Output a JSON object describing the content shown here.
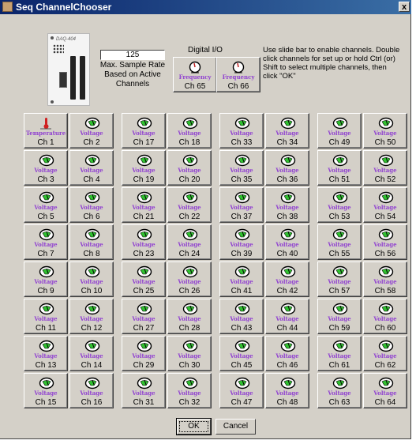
{
  "window": {
    "title": "Seq ChannelChooser",
    "close_label": "x"
  },
  "device": {
    "label": "DAQ-404"
  },
  "rate": {
    "value": "125",
    "label": "Max. Sample Rate Based on Active Channels"
  },
  "digital": {
    "title": "Digital I/O",
    "channels": [
      {
        "type": "Frequency",
        "ch": "Ch 65"
      },
      {
        "type": "Frequency",
        "ch": "Ch 66"
      }
    ]
  },
  "instructions": "Use slide bar to enable channels. Double click channels for set up or hold Ctrl (or) Shift to select multiple channels, then click \"OK\"",
  "groups": [
    {
      "channels": [
        {
          "type": "Temperature",
          "ch": "Ch 1"
        },
        {
          "type": "Voltage",
          "ch": "Ch 2"
        },
        {
          "type": "Voltage",
          "ch": "Ch 3"
        },
        {
          "type": "Voltage",
          "ch": "Ch 4"
        },
        {
          "type": "Voltage",
          "ch": "Ch 5"
        },
        {
          "type": "Voltage",
          "ch": "Ch 6"
        },
        {
          "type": "Voltage",
          "ch": "Ch 7"
        },
        {
          "type": "Voltage",
          "ch": "Ch 8"
        },
        {
          "type": "Voltage",
          "ch": "Ch 9"
        },
        {
          "type": "Voltage",
          "ch": "Ch 10"
        },
        {
          "type": "Voltage",
          "ch": "Ch 11"
        },
        {
          "type": "Voltage",
          "ch": "Ch 12"
        },
        {
          "type": "Voltage",
          "ch": "Ch 13"
        },
        {
          "type": "Voltage",
          "ch": "Ch 14"
        },
        {
          "type": "Voltage",
          "ch": "Ch 15"
        },
        {
          "type": "Voltage",
          "ch": "Ch 16"
        }
      ]
    },
    {
      "channels": [
        {
          "type": "Voltage",
          "ch": "Ch 17"
        },
        {
          "type": "Voltage",
          "ch": "Ch 18"
        },
        {
          "type": "Voltage",
          "ch": "Ch 19"
        },
        {
          "type": "Voltage",
          "ch": "Ch 20"
        },
        {
          "type": "Voltage",
          "ch": "Ch 21"
        },
        {
          "type": "Voltage",
          "ch": "Ch 22"
        },
        {
          "type": "Voltage",
          "ch": "Ch 23"
        },
        {
          "type": "Voltage",
          "ch": "Ch 24"
        },
        {
          "type": "Voltage",
          "ch": "Ch 25"
        },
        {
          "type": "Voltage",
          "ch": "Ch 26"
        },
        {
          "type": "Voltage",
          "ch": "Ch 27"
        },
        {
          "type": "Voltage",
          "ch": "Ch 28"
        },
        {
          "type": "Voltage",
          "ch": "Ch 29"
        },
        {
          "type": "Voltage",
          "ch": "Ch 30"
        },
        {
          "type": "Voltage",
          "ch": "Ch 31"
        },
        {
          "type": "Voltage",
          "ch": "Ch 32"
        }
      ]
    },
    {
      "channels": [
        {
          "type": "Voltage",
          "ch": "Ch 33"
        },
        {
          "type": "Voltage",
          "ch": "Ch 34"
        },
        {
          "type": "Voltage",
          "ch": "Ch 35"
        },
        {
          "type": "Voltage",
          "ch": "Ch 36"
        },
        {
          "type": "Voltage",
          "ch": "Ch 37"
        },
        {
          "type": "Voltage",
          "ch": "Ch 38"
        },
        {
          "type": "Voltage",
          "ch": "Ch 39"
        },
        {
          "type": "Voltage",
          "ch": "Ch 40"
        },
        {
          "type": "Voltage",
          "ch": "Ch 41"
        },
        {
          "type": "Voltage",
          "ch": "Ch 42"
        },
        {
          "type": "Voltage",
          "ch": "Ch 43"
        },
        {
          "type": "Voltage",
          "ch": "Ch 44"
        },
        {
          "type": "Voltage",
          "ch": "Ch 45"
        },
        {
          "type": "Voltage",
          "ch": "Ch 46"
        },
        {
          "type": "Voltage",
          "ch": "Ch 47"
        },
        {
          "type": "Voltage",
          "ch": "Ch 48"
        }
      ]
    },
    {
      "channels": [
        {
          "type": "Voltage",
          "ch": "Ch 49"
        },
        {
          "type": "Voltage",
          "ch": "Ch 50"
        },
        {
          "type": "Voltage",
          "ch": "Ch 51"
        },
        {
          "type": "Voltage",
          "ch": "Ch 52"
        },
        {
          "type": "Voltage",
          "ch": "Ch 53"
        },
        {
          "type": "Voltage",
          "ch": "Ch 54"
        },
        {
          "type": "Voltage",
          "ch": "Ch 55"
        },
        {
          "type": "Voltage",
          "ch": "Ch 56"
        },
        {
          "type": "Voltage",
          "ch": "Ch 57"
        },
        {
          "type": "Voltage",
          "ch": "Ch 58"
        },
        {
          "type": "Voltage",
          "ch": "Ch 59"
        },
        {
          "type": "Voltage",
          "ch": "Ch 60"
        },
        {
          "type": "Voltage",
          "ch": "Ch 61"
        },
        {
          "type": "Voltage",
          "ch": "Ch 62"
        },
        {
          "type": "Voltage",
          "ch": "Ch 63"
        },
        {
          "type": "Voltage",
          "ch": "Ch 64"
        }
      ]
    }
  ],
  "buttons": {
    "ok": "OK",
    "cancel": "Cancel"
  },
  "colors": {
    "type_text": "#9040d0",
    "voltage_icon": "#30c030",
    "temperature_icon": "#d02020"
  }
}
